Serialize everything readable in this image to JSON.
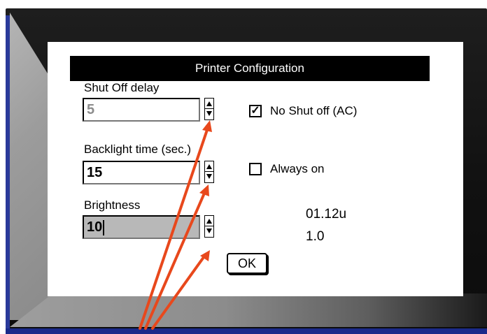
{
  "dialog": {
    "title": "Printer Configuration",
    "shut_off": {
      "label": "Shut Off delay",
      "value": "5"
    },
    "backlight": {
      "label": "Backlight time (sec.)",
      "value": "15"
    },
    "brightness": {
      "label": "Brightness",
      "value": "10"
    },
    "no_shut_off": {
      "label": "No Shut off (AC)",
      "checked": true,
      "mark": "✓"
    },
    "always_on": {
      "label": "Always on",
      "checked": false
    },
    "version": {
      "firmware": "01.12u",
      "hardware": "1.0"
    },
    "ok_label": "OK"
  },
  "colors": {
    "arrow": "#e8481c",
    "screen": "#111111",
    "bezel_blue": "#1a2a8a"
  }
}
